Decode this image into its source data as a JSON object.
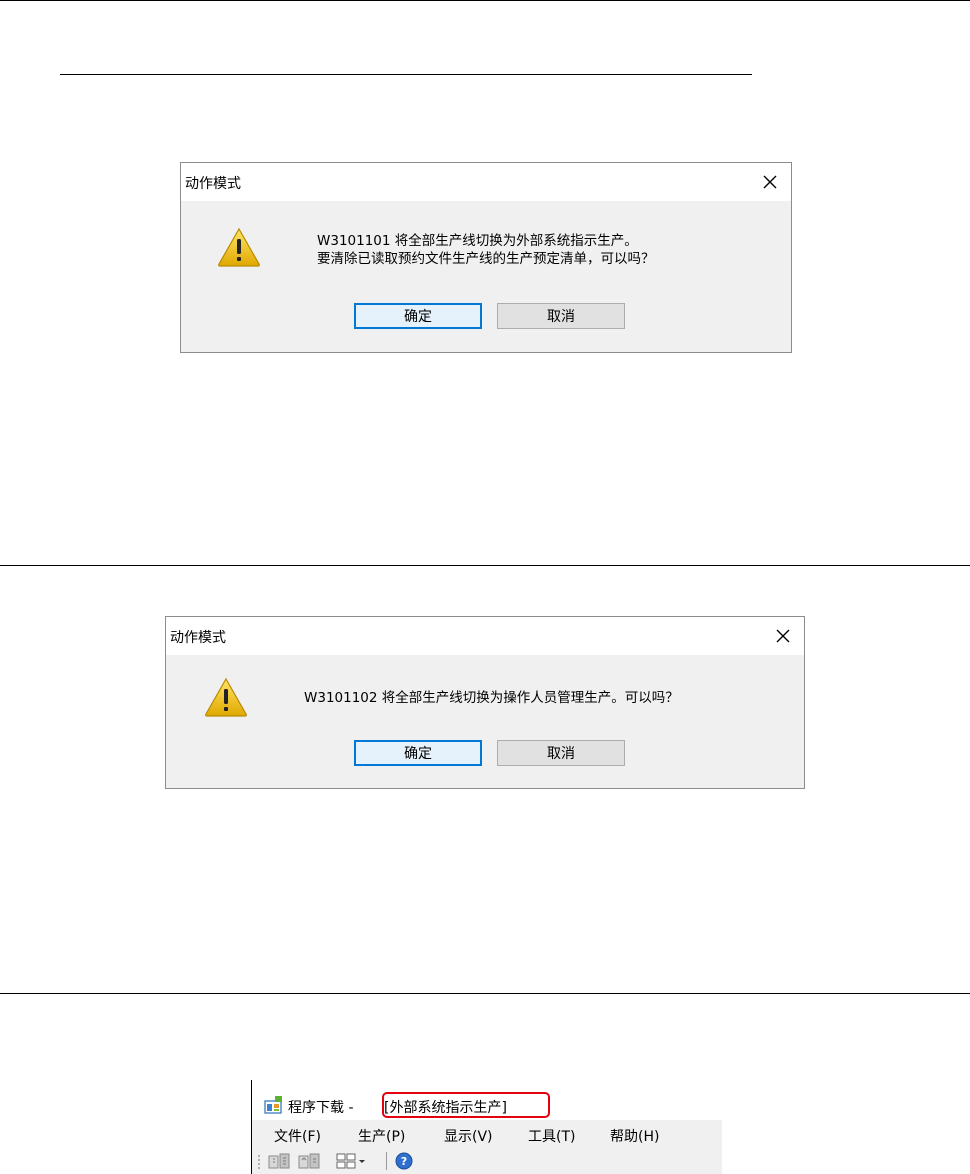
{
  "dialog1": {
    "title": "动作模式",
    "message_line1": "W3101101 将全部生产线切换为外部系统指示生产。",
    "message_line2": "要清除已读取预约文件生产线的生产预定清单，可以吗？",
    "ok_label": "确定",
    "cancel_label": "取消",
    "icon": "warning-icon"
  },
  "dialog2": {
    "title": "动作模式",
    "message_line1": "W3101102 将全部生产线切换为操作人员管理生产。可以吗？",
    "ok_label": "确定",
    "cancel_label": "取消",
    "icon": "warning-icon"
  },
  "app_window": {
    "title": "程序下载 - ",
    "mode_label": "[外部系统指示生产]",
    "menu": [
      {
        "label": "文件(F)"
      },
      {
        "label": "生产(P)"
      },
      {
        "label": "显示(V)"
      },
      {
        "label": "工具(T)"
      },
      {
        "label": "帮助(H)"
      }
    ],
    "toolbar_icons": [
      "download-icon",
      "upload-icon",
      "view-layout-icon",
      "help-icon"
    ]
  },
  "colors": {
    "dialog_bg": "#f0f0f0",
    "primary_button_border": "#0078d7",
    "highlight_red": "#e4000f",
    "warning_yellow": "#f5c400"
  }
}
